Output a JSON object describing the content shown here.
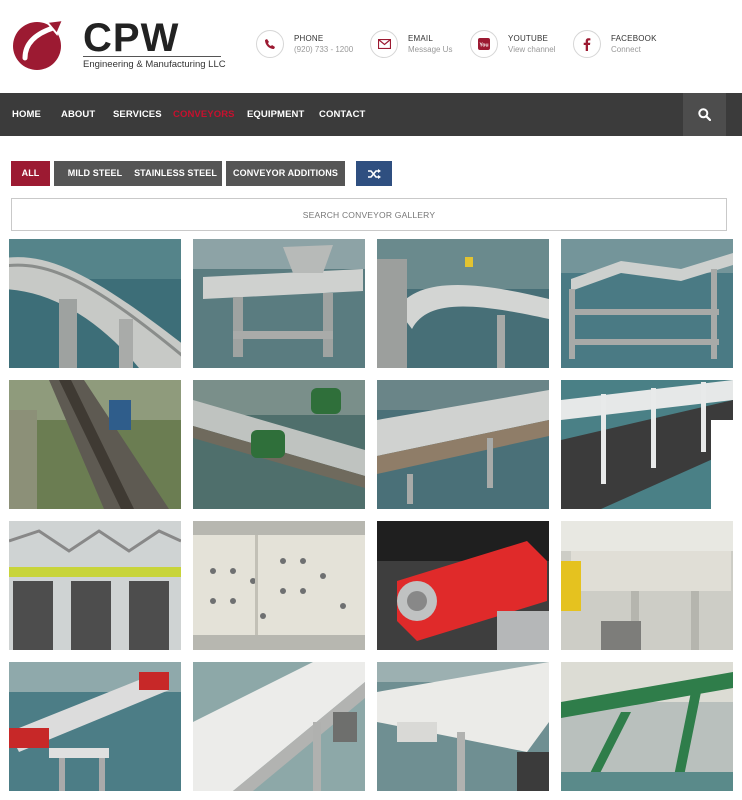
{
  "brand": {
    "name": "CPW",
    "subtitle": "Engineering & Manufacturing LLC",
    "colors": {
      "accent": "#9c1a32",
      "nav_bg": "#3b3b3b",
      "shuffle": "#2f4f80"
    }
  },
  "contacts": [
    {
      "label": "PHONE",
      "value": "(920) 733 - 1200",
      "icon": "phone-icon"
    },
    {
      "label": "EMAIL",
      "value": "Message Us",
      "icon": "envelope-icon"
    },
    {
      "label": "YOUTUBE",
      "value": "View channel",
      "icon": "youtube-icon"
    },
    {
      "label": "FACEBOOK",
      "value": "Connect",
      "icon": "facebook-icon"
    }
  ],
  "nav": {
    "items": [
      "HOME",
      "ABOUT",
      "SERVICES",
      "CONVEYORS",
      "EQUIPMENT",
      "CONTACT"
    ],
    "active": "CONVEYORS",
    "search_icon": "search-icon"
  },
  "filters": {
    "items": [
      "ALL",
      "MILD STEEL",
      "STAINLESS STEEL",
      "CONVEYOR ADDITIONS"
    ],
    "active": "ALL",
    "shuffle_icon": "shuffle-icon"
  },
  "search": {
    "placeholder": "SEARCH CONVEYOR GALLERY"
  },
  "gallery": {
    "tiles": [
      "stainless-curved-conveyor-photo",
      "stainless-conveyor-hopper-photo",
      "stainless-curved-belt-photo",
      "stainless-incline-conveyor-frame-photo",
      "mild-steel-chain-conveyor-photo",
      "green-motor-conveyor-photo",
      "stainless-flat-top-conveyor-photo",
      "white-railed-conveyor-photo",
      "multi-lane-conveyor-photo",
      "white-bolted-panel-photo",
      "red-drive-guard-photo",
      "white-conveyor-yellow-motor-photo",
      "red-incline-belt-conveyor-photo",
      "white-belt-conveyor-photo",
      "white-belt-conveyor-stand-photo",
      "green-frame-incline-conveyor-photo"
    ]
  }
}
